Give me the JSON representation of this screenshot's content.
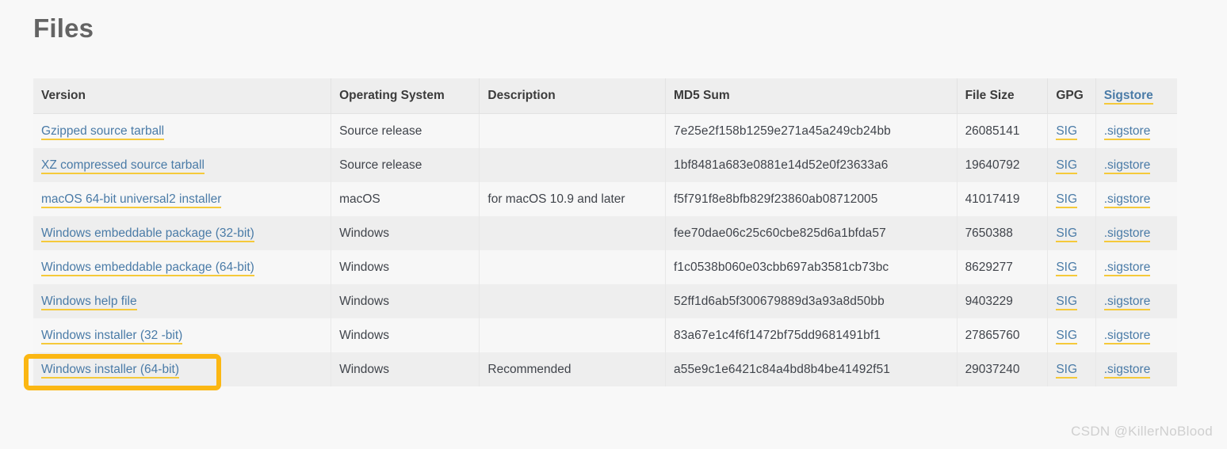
{
  "page": {
    "title": "Files",
    "background_color": "#f8f8f8",
    "heading_color": "#646464"
  },
  "table": {
    "columns": [
      {
        "key": "version",
        "label": "Version",
        "is_link": false
      },
      {
        "key": "os",
        "label": "Operating System",
        "is_link": false
      },
      {
        "key": "description",
        "label": "Description",
        "is_link": false
      },
      {
        "key": "md5",
        "label": "MD5 Sum",
        "is_link": false
      },
      {
        "key": "size",
        "label": "File Size",
        "is_link": false
      },
      {
        "key": "gpg",
        "label": "GPG",
        "is_link": false
      },
      {
        "key": "sigstore",
        "label": "Sigstore",
        "is_link": true
      }
    ],
    "rows": [
      {
        "version": "Gzipped source tarball",
        "os": "Source release",
        "description": "",
        "md5": "7e25e2f158b1259e271a45a249cb24bb",
        "size": "26085141",
        "gpg": "SIG",
        "sigstore": ".sigstore"
      },
      {
        "version": "XZ compressed source tarball",
        "os": "Source release",
        "description": "",
        "md5": "1bf8481a683e0881e14d52e0f23633a6",
        "size": "19640792",
        "gpg": "SIG",
        "sigstore": ".sigstore"
      },
      {
        "version": "macOS 64-bit universal2 installer",
        "os": "macOS",
        "description": "for macOS 10.9 and later",
        "md5": "f5f791f8e8bfb829f23860ab08712005",
        "size": "41017419",
        "gpg": "SIG",
        "sigstore": ".sigstore"
      },
      {
        "version": "Windows embeddable package (32-bit)",
        "os": "Windows",
        "description": "",
        "md5": "fee70dae06c25c60cbe825d6a1bfda57",
        "size": "7650388",
        "gpg": "SIG",
        "sigstore": ".sigstore"
      },
      {
        "version": "Windows embeddable package (64-bit)",
        "os": "Windows",
        "description": "",
        "md5": "f1c0538b060e03cbb697ab3581cb73bc",
        "size": "8629277",
        "gpg": "SIG",
        "sigstore": ".sigstore"
      },
      {
        "version": "Windows help file",
        "os": "Windows",
        "description": "",
        "md5": "52ff1d6ab5f300679889d3a93a8d50bb",
        "size": "9403229",
        "gpg": "SIG",
        "sigstore": ".sigstore"
      },
      {
        "version": "Windows installer (32 -bit)",
        "os": "Windows",
        "description": "",
        "md5": "83a67e1c4f6f1472bf75dd9681491bf1",
        "size": "27865760",
        "gpg": "SIG",
        "sigstore": ".sigstore"
      },
      {
        "version": "Windows installer (64-bit)",
        "os": "Windows",
        "description": "Recommended",
        "md5": "a55e9c1e6421c84a4bd8b4be41492f51",
        "size": "29037240",
        "gpg": "SIG",
        "sigstore": ".sigstore"
      }
    ]
  },
  "annotation": {
    "highlight_target": "Windows installer (64-bit)",
    "border_color": "#fbb713"
  },
  "watermark": {
    "text": "CSDN @KillerNoBlood",
    "color": "#cfcfcf"
  }
}
